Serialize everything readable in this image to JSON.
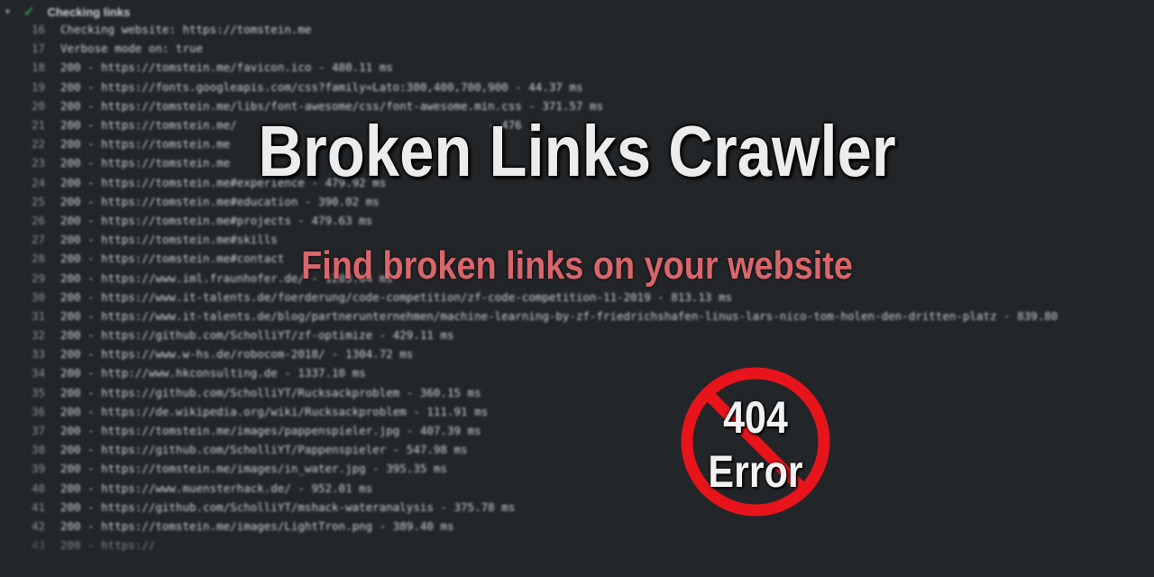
{
  "step": {
    "title": "Checking links"
  },
  "log": {
    "lines": [
      {
        "num": "16",
        "text": "Checking website: https://tomstein.me"
      },
      {
        "num": "17",
        "text": "Verbose mode on: true"
      },
      {
        "num": "18",
        "text": "200 - https://tomstein.me/favicon.ico - 480.11 ms"
      },
      {
        "num": "19",
        "text": "200 - https://fonts.googleapis.com/css?family=Lato:300,400,700,900 - 44.37 ms"
      },
      {
        "num": "20",
        "text": "200 - https://tomstein.me/libs/font-awesome/css/font-awesome.min.css - 371.57 ms"
      },
      {
        "num": "21",
        "text": "200 - https://tomstein.me/                                     - 476"
      },
      {
        "num": "22",
        "text": "200 - https://tomstein.me"
      },
      {
        "num": "23",
        "text": "200 - https://tomstein.me"
      },
      {
        "num": "24",
        "text": "200 - https://tomstein.me#experience - 479.92 ms"
      },
      {
        "num": "25",
        "text": "200 - https://tomstein.me#education - 390.02 ms"
      },
      {
        "num": "26",
        "text": "200 - https://tomstein.me#projects - 479.63 ms"
      },
      {
        "num": "27",
        "text": "200 - https://tomstein.me#skills"
      },
      {
        "num": "28",
        "text": "200 - https://tomstein.me#contact"
      },
      {
        "num": "29",
        "text": "200 - https://www.iml.fraunhofer.de/ - 1203.64 ms"
      },
      {
        "num": "30",
        "text": "200 - https://www.it-talents.de/foerderung/code-competition/zf-code-competition-11-2019 - 813.13 ms"
      },
      {
        "num": "31",
        "text": "200 - https://www.it-talents.de/blog/partnerunternehmen/machine-learning-by-zf-friedrichshafen-linus-lars-nico-tom-holen-den-dritten-platz - 839.80"
      },
      {
        "num": "32",
        "text": "200 - https://github.com/ScholliYT/zf-optimize - 429.11 ms"
      },
      {
        "num": "33",
        "text": "200 - https://www.w-hs.de/robocom-2018/ - 1304.72 ms"
      },
      {
        "num": "34",
        "text": "200 - http://www.hkconsulting.de - 1337.10 ms"
      },
      {
        "num": "35",
        "text": "200 - https://github.com/ScholliYT/Rucksackproblem - 360.15 ms"
      },
      {
        "num": "36",
        "text": "200 - https://de.wikipedia.org/wiki/Rucksackproblem - 111.91 ms"
      },
      {
        "num": "37",
        "text": "200 - https://tomstein.me/images/pappenspieler.jpg - 407.39 ms"
      },
      {
        "num": "38",
        "text": "200 - https://github.com/ScholliYT/Pappenspieler - 547.98 ms"
      },
      {
        "num": "39",
        "text": "200 - https://tomstein.me/images/in_water.jpg - 395.35 ms"
      },
      {
        "num": "40",
        "text": "200 - https://www.muensterhack.de/ - 952.01 ms"
      },
      {
        "num": "41",
        "text": "200 - https://github.com/ScholliYT/mshack-wateranalysis - 375.78 ms"
      },
      {
        "num": "42",
        "text": "200 - https://tomstein.me/images/LightTron.png - 389.40 ms"
      },
      {
        "num": "43",
        "text": "200 - https://"
      }
    ]
  },
  "banner": {
    "title": "Broken Links Crawler",
    "subtitle": "Find broken links on your website"
  },
  "badge": {
    "code": "404",
    "label": "Error"
  },
  "colors": {
    "subtitle": "#d9666a",
    "prohibition": "#e8141b",
    "success": "#28a745"
  }
}
